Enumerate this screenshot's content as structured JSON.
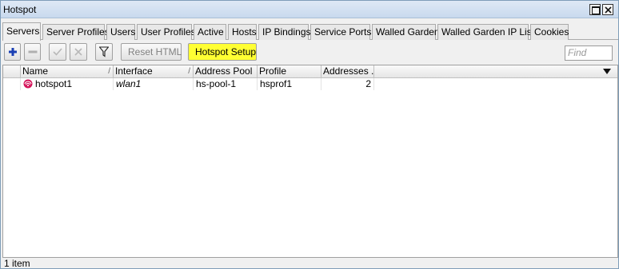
{
  "window": {
    "title": "Hotspot"
  },
  "tabs": [
    {
      "label": "Servers",
      "active": true
    },
    {
      "label": "Server Profiles"
    },
    {
      "label": "Users"
    },
    {
      "label": "User Profiles"
    },
    {
      "label": "Active"
    },
    {
      "label": "Hosts"
    },
    {
      "label": "IP Bindings"
    },
    {
      "label": "Service Ports"
    },
    {
      "label": "Walled Garden"
    },
    {
      "label": "Walled Garden IP List"
    },
    {
      "label": "Cookies"
    }
  ],
  "toolbar": {
    "reset_html": "Reset HTML",
    "hotspot_setup": "Hotspot Setup",
    "find_placeholder": "Find",
    "highlight_color": "#ffff33"
  },
  "table": {
    "columns": [
      "Name",
      "Interface",
      "Address Pool",
      "Profile",
      "Addresses ..."
    ],
    "rows": [
      {
        "name": "hotspot1",
        "interface": "wlan1",
        "address_pool": "hs-pool-1",
        "profile": "hsprof1",
        "addresses": "2"
      }
    ]
  },
  "status": {
    "count": "1 item"
  }
}
